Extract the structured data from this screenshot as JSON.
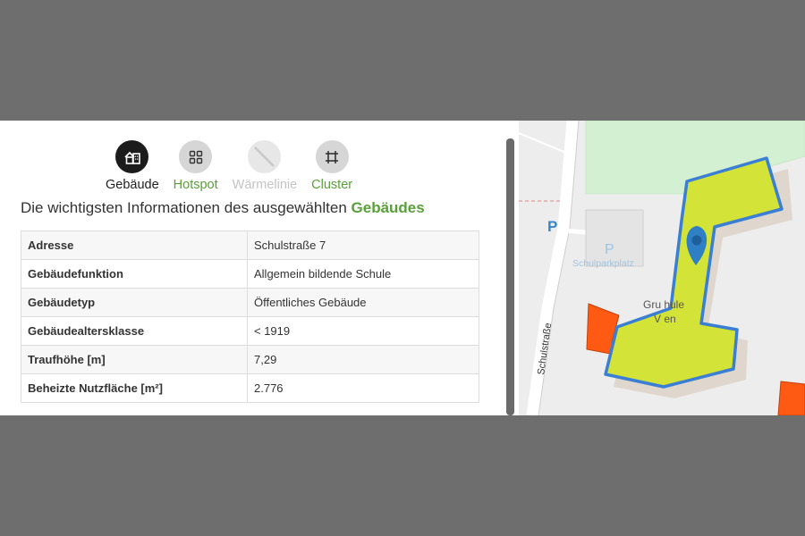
{
  "tabs": [
    {
      "label": "Gebäude",
      "icon": "building-icon",
      "state": "active"
    },
    {
      "label": "Hotspot",
      "icon": "grid-icon",
      "state": "available"
    },
    {
      "label": "Wärmelinie",
      "icon": "line-icon",
      "state": "disabled"
    },
    {
      "label": "Cluster",
      "icon": "crop-icon",
      "state": "available"
    }
  ],
  "heading": {
    "prefix": "Die wichtigsten Informationen des ausgewählten",
    "highlight": "Gebäudes"
  },
  "table": {
    "rows": [
      {
        "key": "Adresse",
        "value": "Schulstraße 7"
      },
      {
        "key": "Gebäudefunktion",
        "value": "Allgemein bildende Schule"
      },
      {
        "key": "Gebäudetyp",
        "value": "Öffentliches Gebäude"
      },
      {
        "key": "Gebäudealtersklasse",
        "value": "< 1919"
      },
      {
        "key": "Traufhöhe [m]",
        "value": "7,29"
      },
      {
        "key": "Beheizte Nutzfläche [m²]",
        "value": "2.776"
      }
    ]
  },
  "map": {
    "street_label": "Schulstraße",
    "parking_label": "Schulparkplatz",
    "parking_symbol": "P",
    "school_label_line1": "Gru   hule",
    "school_label_line2": "V       en",
    "colors": {
      "selected_fill": "#d4e337",
      "selected_outline": "#3a7fd4",
      "building": "#ff5a14",
      "park": "#d4f0d2",
      "marker": "#2f7fc4"
    }
  }
}
